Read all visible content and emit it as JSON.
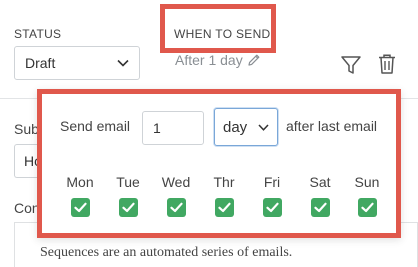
{
  "status": {
    "label": "STATUS",
    "value": "Draft"
  },
  "when_to_send": {
    "label": "WHEN TO SEND",
    "summary": "After 1 day"
  },
  "side": {
    "subject_label": "Sub",
    "subject_value": "Ho",
    "content_label": "Con",
    "editor_text": "Sequences are an automated series of emails."
  },
  "popover": {
    "send_label": "Send email",
    "delay_value": "1",
    "unit_value": "day",
    "after_label": "after last email",
    "days": [
      {
        "label": "Mon",
        "checked": true
      },
      {
        "label": "Tue",
        "checked": true
      },
      {
        "label": "Wed",
        "checked": true
      },
      {
        "label": "Thr",
        "checked": true
      },
      {
        "label": "Fri",
        "checked": true
      },
      {
        "label": "Sat",
        "checked": true
      },
      {
        "label": "Sun",
        "checked": true
      }
    ]
  },
  "icons": {
    "filter": "filter-icon",
    "trash": "trash-icon",
    "pencil": "pencil-icon",
    "chevron": "chevron-down-icon",
    "check": "check-icon"
  },
  "colors": {
    "highlight": "#e0584c",
    "checkbox": "#41a862",
    "focus_border": "#7aa7d8"
  }
}
